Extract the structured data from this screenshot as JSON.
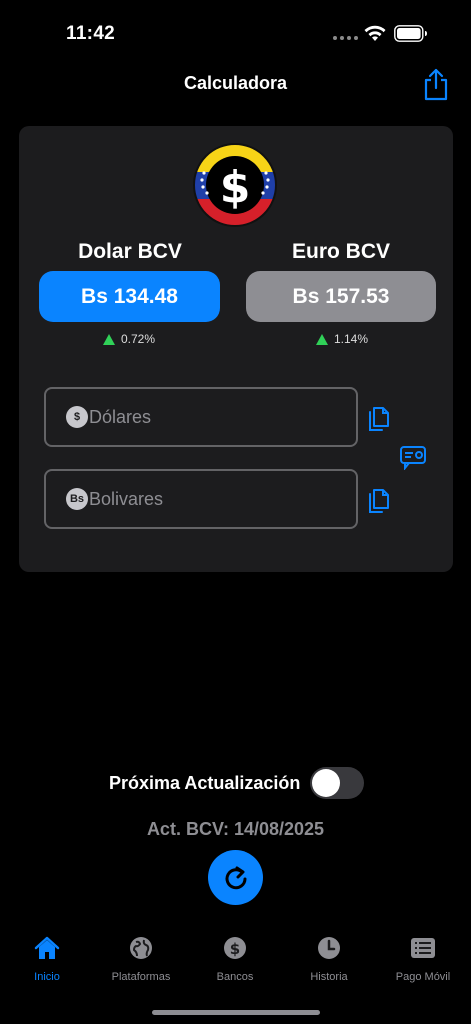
{
  "status": {
    "time": "11:42"
  },
  "nav": {
    "title": "Calculadora"
  },
  "rates": {
    "usd": {
      "label": "Dolar BCV",
      "value": "Bs 134.48",
      "change": "0.72%"
    },
    "eur": {
      "label": "Euro BCV",
      "value": "Bs 157.53",
      "change": "1.14%"
    }
  },
  "inputs": {
    "dollars": {
      "placeholder": "Dólares",
      "value": "",
      "icon": "dollar-circle-icon"
    },
    "bolivares": {
      "placeholder": "Bolivares",
      "value": "",
      "icon": "bs-circle-icon",
      "icon_text": "Bs"
    }
  },
  "update": {
    "toggle_label": "Próxima Actualización",
    "toggle_on": false,
    "last_update": "Act. BCV: 14/08/2025"
  },
  "tabs": [
    {
      "label": "Inicio",
      "icon": "house-icon",
      "active": true
    },
    {
      "label": "Plataformas",
      "icon": "globe-icon",
      "active": false
    },
    {
      "label": "Bancos",
      "icon": "dollar-coin-icon",
      "active": false
    },
    {
      "label": "Historia",
      "icon": "clock-icon",
      "active": false
    },
    {
      "label": "Pago Móvil",
      "icon": "list-icon",
      "active": false
    }
  ],
  "colors": {
    "accent": "#0a84ff",
    "card": "#1c1c1e",
    "up": "#30d158",
    "inactive": "#8e8e93"
  }
}
